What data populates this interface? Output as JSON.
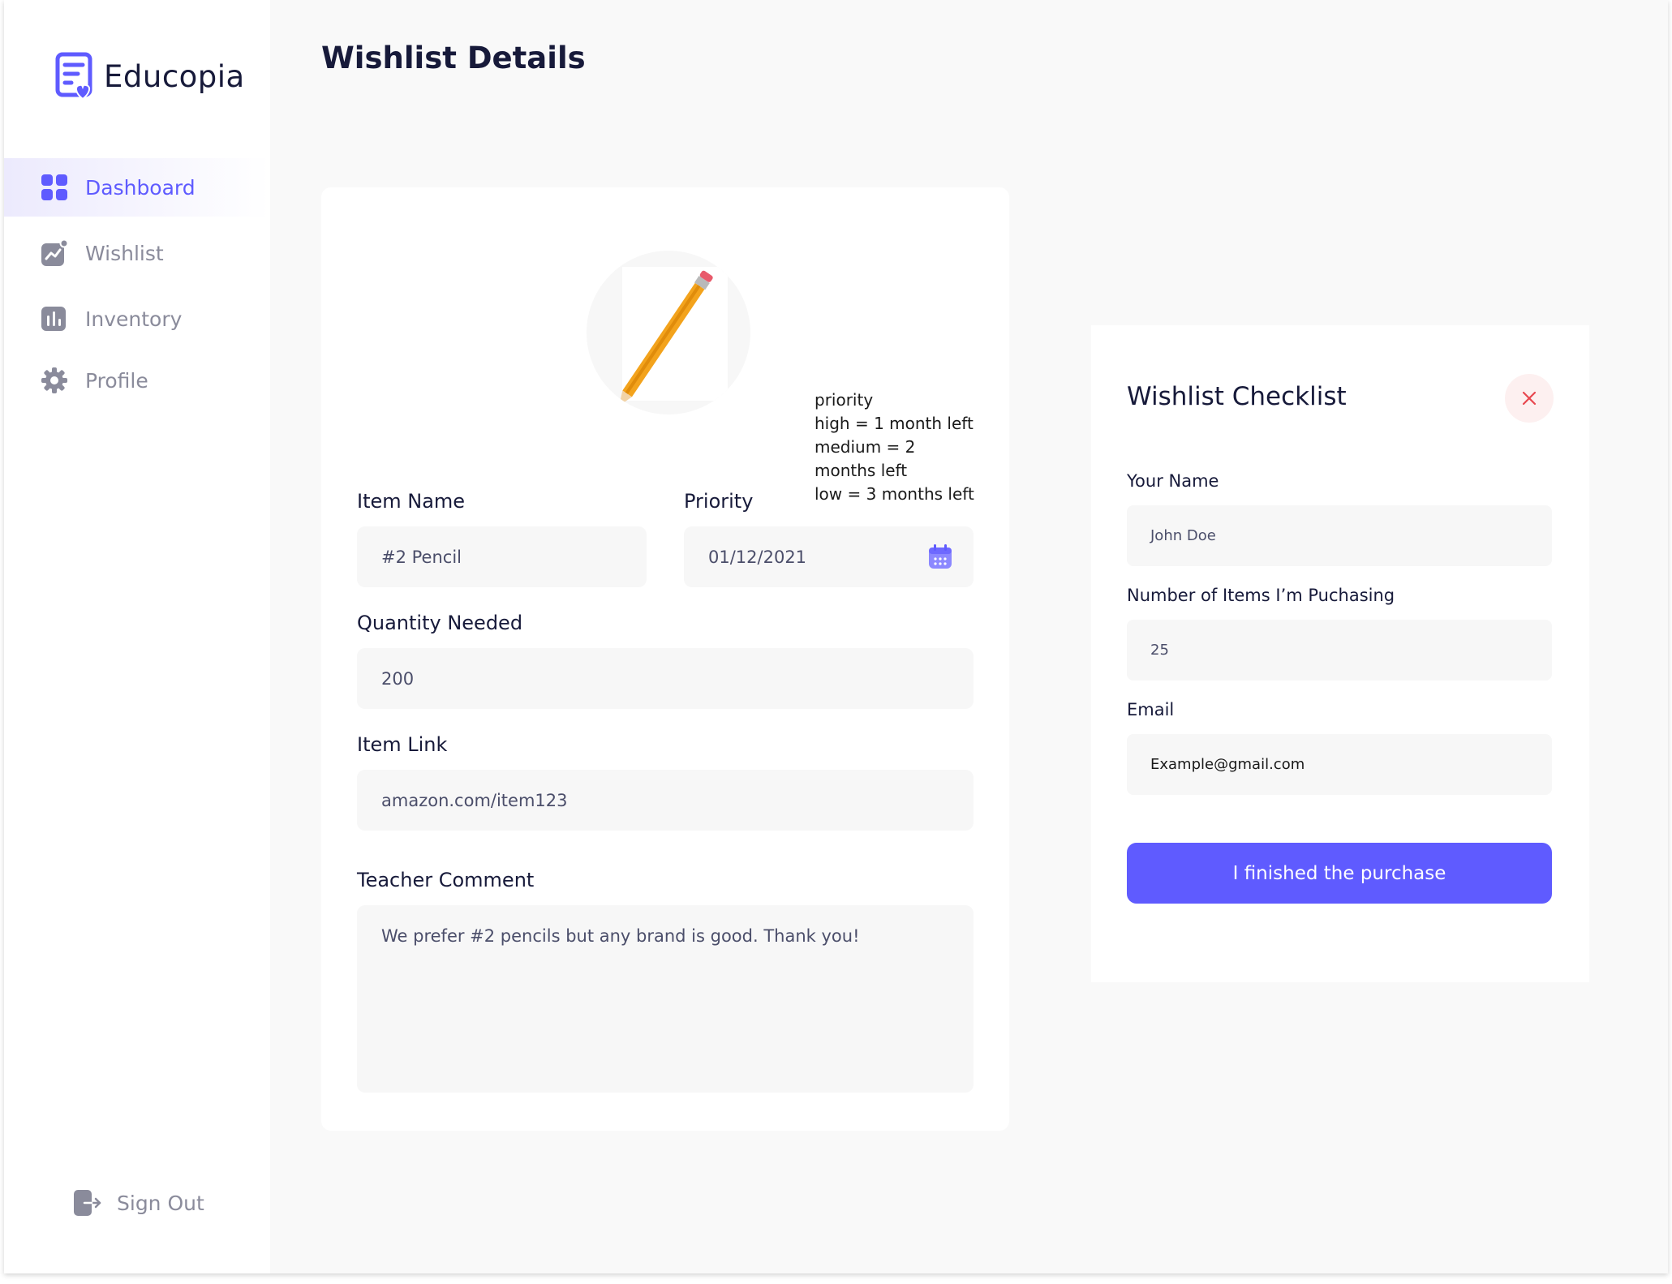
{
  "app": {
    "name": "Educopia"
  },
  "sidebar": {
    "items": [
      {
        "label": "Dashboard",
        "icon": "grid-icon",
        "active": true
      },
      {
        "label": "Wishlist",
        "icon": "chart-icon",
        "active": false
      },
      {
        "label": "Inventory",
        "icon": "bar-chart-icon",
        "active": false
      },
      {
        "label": "Profile",
        "icon": "gear-icon",
        "active": false
      }
    ],
    "signout_label": "Sign Out"
  },
  "header": {
    "title": "Wishlist Details"
  },
  "details": {
    "priority_note": "priority\nhigh = 1 month left\nmedium = 2 months left\nlow = 3 months left",
    "item_name": {
      "label": "Item Name",
      "value": "#2 Pencil"
    },
    "priority": {
      "label": "Priority",
      "value": "01/12/2021"
    },
    "quantity": {
      "label": "Quantity Needed",
      "value": "200"
    },
    "link": {
      "label": "Item Link",
      "value": "amazon.com/item123"
    },
    "comment": {
      "label": "Teacher Comment",
      "value": "We prefer #2 pencils but any brand is good. Thank you!"
    }
  },
  "checklist": {
    "title": "Wishlist Checklist",
    "name": {
      "label": "Your Name",
      "placeholder": "John Doe"
    },
    "items": {
      "label": "Number of Items I’m Puchasing",
      "placeholder": "25"
    },
    "email": {
      "label": "Email",
      "value": "Example@gmail.com"
    },
    "submit_label": "I finished the purchase"
  },
  "colors": {
    "accent": "#5f5bff",
    "muted": "#8a8b9b",
    "close": "#e8474f",
    "field_bg": "#f7f7f7"
  }
}
